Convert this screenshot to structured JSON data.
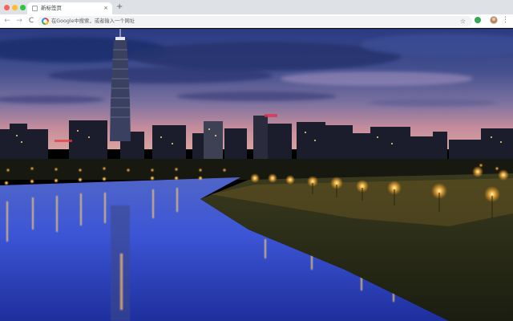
{
  "browser": {
    "tab": {
      "title": "新标签页",
      "close_glyph": "×"
    },
    "new_tab_glyph": "+",
    "nav": {
      "back_glyph": "←",
      "forward_glyph": "→",
      "reload_glyph": "C"
    },
    "omnibox": {
      "placeholder": "在Google中搜索，或者输入一个网址"
    },
    "star_glyph": "☆",
    "menu_glyph": "⋮",
    "icons": [
      "close-dot",
      "minimize-dot",
      "maximize-dot",
      "favicon",
      "google-g-icon",
      "star-icon",
      "extension-icon",
      "profile-icon",
      "menu-icon"
    ]
  },
  "wallpaper": {
    "subject": "Taipei skyline at dusk reflected in river",
    "colors": {
      "sky_top": "#283a80",
      "sky_mid": "#6e6fa6",
      "sky_glow": "#e0a0a8",
      "water": "#3a52d8",
      "lights": "#ffc04a"
    }
  }
}
